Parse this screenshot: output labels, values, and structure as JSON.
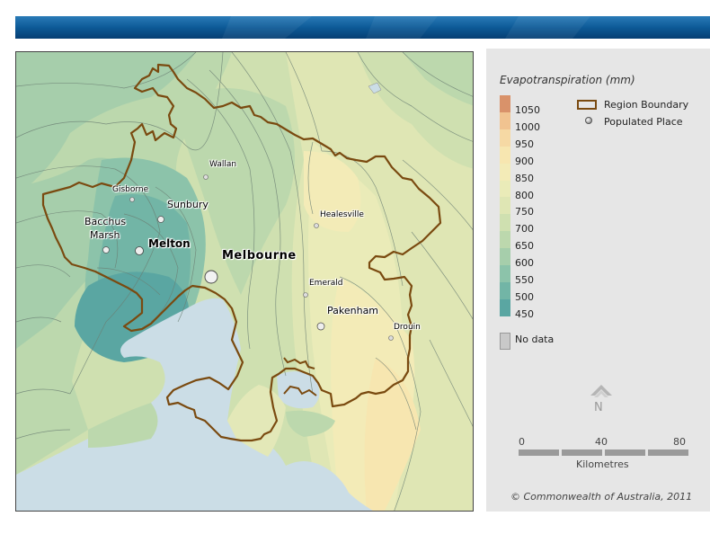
{
  "legend": {
    "title": "Evapotranspiration (mm)",
    "classes": [
      {
        "label": "1050",
        "color": "#d9926a"
      },
      {
        "label": "1000",
        "color": "#f1c390"
      },
      {
        "label": "950",
        "color": "#f6d9a4"
      },
      {
        "label": "900",
        "color": "#f7e6b0"
      },
      {
        "label": "850",
        "color": "#f3ebb7"
      },
      {
        "label": "800",
        "color": "#eaebb8"
      },
      {
        "label": "750",
        "color": "#dfe6b4"
      },
      {
        "label": "700",
        "color": "#cfe0b0"
      },
      {
        "label": "650",
        "color": "#bcd8ad"
      },
      {
        "label": "600",
        "color": "#a6ceab"
      },
      {
        "label": "550",
        "color": "#8cc3aa"
      },
      {
        "label": "500",
        "color": "#72b5a6"
      },
      {
        "label": "450",
        "color": "#5aa6a2"
      }
    ],
    "no_data_label": "No data",
    "no_data_color": "#c9c9c9",
    "region_boundary_label": "Region Boundary",
    "region_boundary_color": "#7a4a10",
    "populated_place_label": "Populated Place",
    "populated_place_icon": "populated-place-dot",
    "north_label": "N",
    "north_icon": "north-arrow-icon",
    "scale_ticks": [
      "0",
      "40",
      "80"
    ],
    "scale_units": "Kilometres",
    "copyright": "© Commonwealth of Australia, 2011"
  },
  "places": [
    {
      "name": "Wallan"
    },
    {
      "name": "Gisborne"
    },
    {
      "name": "Sunbury"
    },
    {
      "name": "Healesville"
    },
    {
      "name": "Bacchus"
    },
    {
      "name": "Marsh"
    },
    {
      "name": "Melton"
    },
    {
      "name": "Melbourne"
    },
    {
      "name": "Emerald"
    },
    {
      "name": "Pakenham"
    },
    {
      "name": "Drouin"
    }
  ]
}
